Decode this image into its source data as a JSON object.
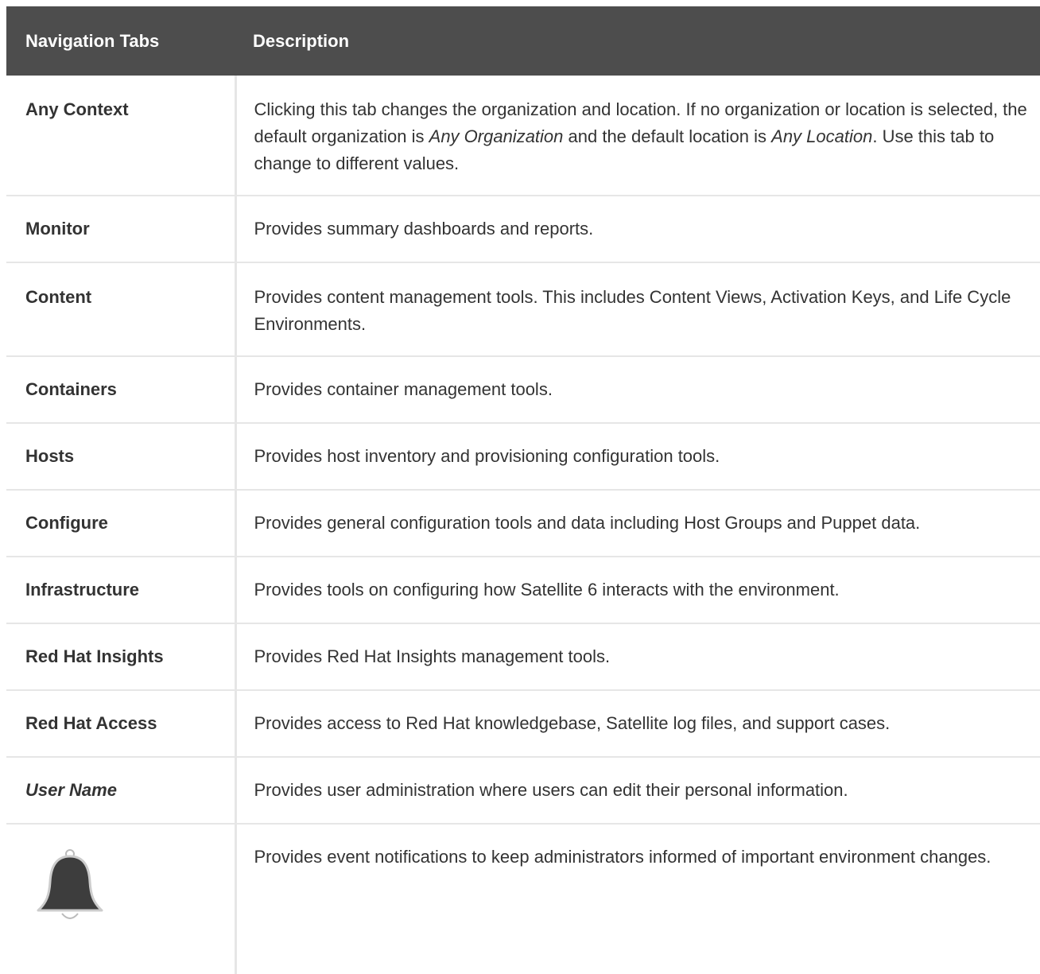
{
  "table": {
    "headers": [
      "Navigation Tabs",
      "Description"
    ],
    "rows": [
      {
        "name": "Any Context",
        "desc_parts": [
          "Clicking this tab changes the organization and location. If no organization or location is selected, the default organization is ",
          "Any Organization",
          " and the default location is ",
          "Any Location",
          ". Use this tab to change to different values."
        ]
      },
      {
        "name": "Monitor",
        "desc": "Provides summary dashboards and reports."
      },
      {
        "name": "Content",
        "desc": "Provides content management tools. This includes Content Views, Activation Keys, and Life Cycle Environments."
      },
      {
        "name": "Containers",
        "desc": "Provides container management tools."
      },
      {
        "name": "Hosts",
        "desc": "Provides host inventory and provisioning configuration tools."
      },
      {
        "name": "Configure",
        "desc": "Provides general configuration tools and data including Host Groups and Puppet data."
      },
      {
        "name": "Infrastructure",
        "desc": "Provides tools on configuring how Satellite 6 interacts with the environment."
      },
      {
        "name": "Red Hat Insights",
        "desc": "Provides Red Hat Insights management tools."
      },
      {
        "name": "Red Hat Access",
        "desc": "Provides access to Red Hat knowledgebase, Satellite log files, and support cases."
      },
      {
        "name": "User Name",
        "desc": "Provides user administration where users can edit their personal information."
      },
      {
        "icon": "bell-icon",
        "desc": "Provides event notifications to keep administrators informed of important environment changes."
      }
    ]
  },
  "colors": {
    "header_bg": "#4d4d4d",
    "header_text": "#ffffff",
    "body_text": "#333333",
    "border": "#e6e6e6"
  }
}
